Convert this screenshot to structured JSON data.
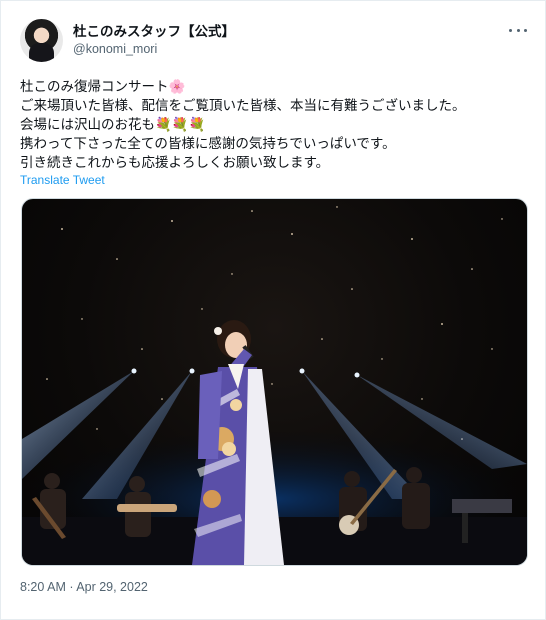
{
  "account": {
    "display_name": "杜このみスタッフ【公式】",
    "handle": "@konomi_mori",
    "avatar_icon": "profile-photo"
  },
  "tweet": {
    "text": "杜このみ復帰コンサート🌸\nご来場頂いた皆様、配信をご覧頂いた皆様、本当に有難うございました。\n会場には沢山のお花も💐💐💐\n携わって下さった全ての皆様に感謝の気持ちでいっぱいです。\n引き続きこれからも応援よろしくお願い致します。",
    "translate_label": "Translate Tweet",
    "timestamp": "8:20 AM · Apr 29, 2022"
  },
  "more_icon": "more-horizontal-icon",
  "colors": {
    "link": "#1d9bf0",
    "secondary_text": "#536471",
    "kimono_purple": "#5a4fa8"
  }
}
